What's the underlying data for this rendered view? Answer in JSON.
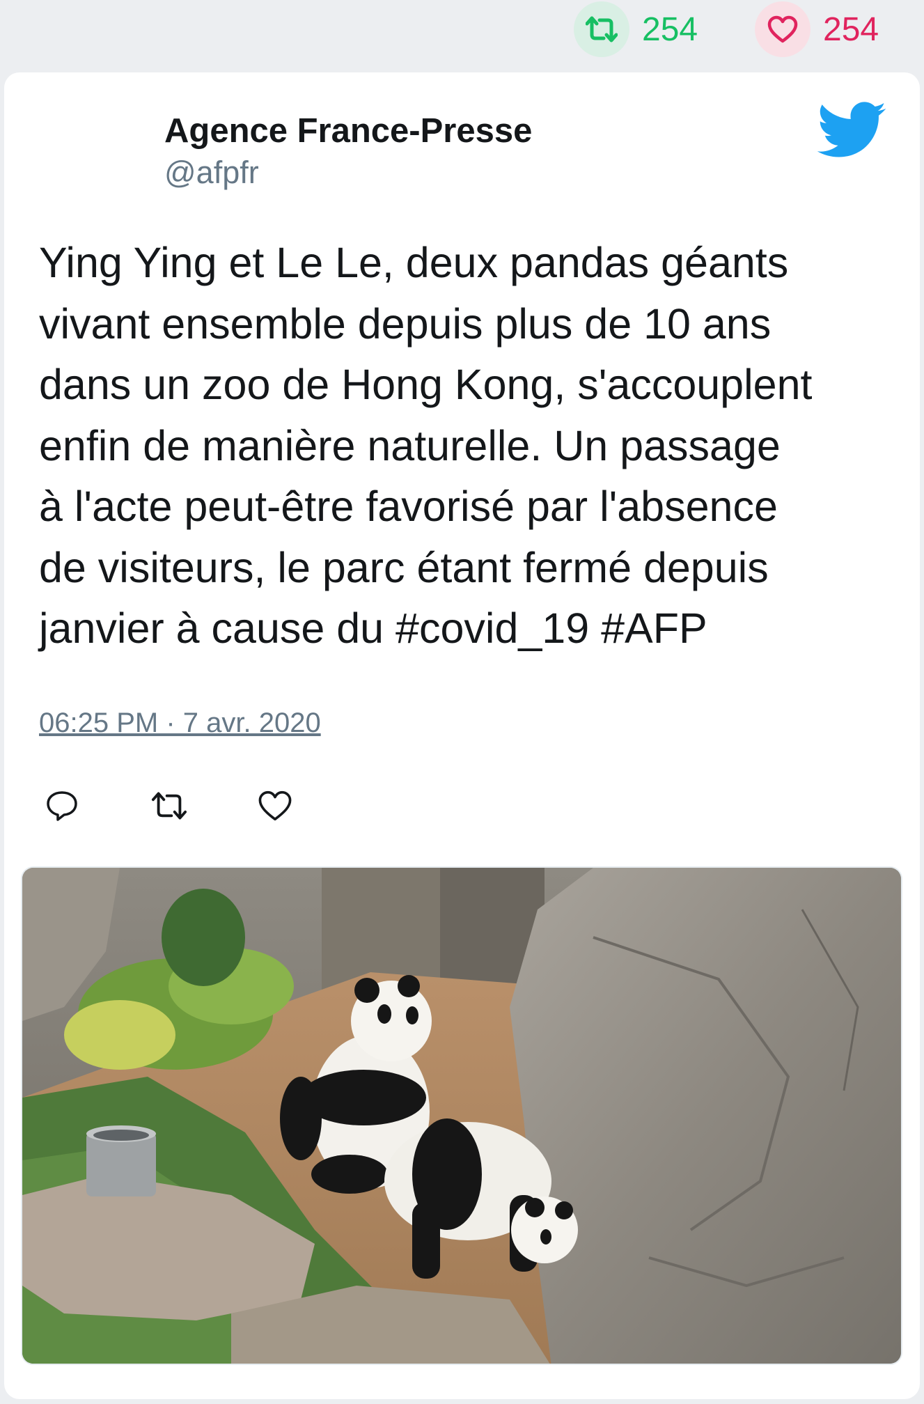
{
  "header_stats": {
    "retweet_count": "254",
    "like_count": "254",
    "retweet_icon": "retweet-icon",
    "like_icon": "heart-icon"
  },
  "tweet": {
    "author_name": "Agence France-Presse",
    "author_handle": "@afpfr",
    "logo_icon": "twitter-bird-icon",
    "text": "Ying Ying et Le Le, deux pandas géants\nvivant ensemble depuis plus de 10 ans\ndans un zoo de Hong Kong, s'accouplent\nenfin de manière naturelle. Un passage\nà l'acte peut-être favorisé par l'absence\nde visiteurs, le parc étant fermé depuis\njanvier à cause du #covid_19 #AFP",
    "timestamp": "06:25 PM · 7 avr. 2020",
    "actions": [
      "reply-icon",
      "retweet-icon",
      "like-icon"
    ],
    "media_description_icon": "photo-image"
  },
  "colors": {
    "background": "#eceef1",
    "retweet_green": "#17bf63",
    "like_red": "#e0245e",
    "twitter_blue": "#1da1f2",
    "muted_text": "#657786"
  }
}
